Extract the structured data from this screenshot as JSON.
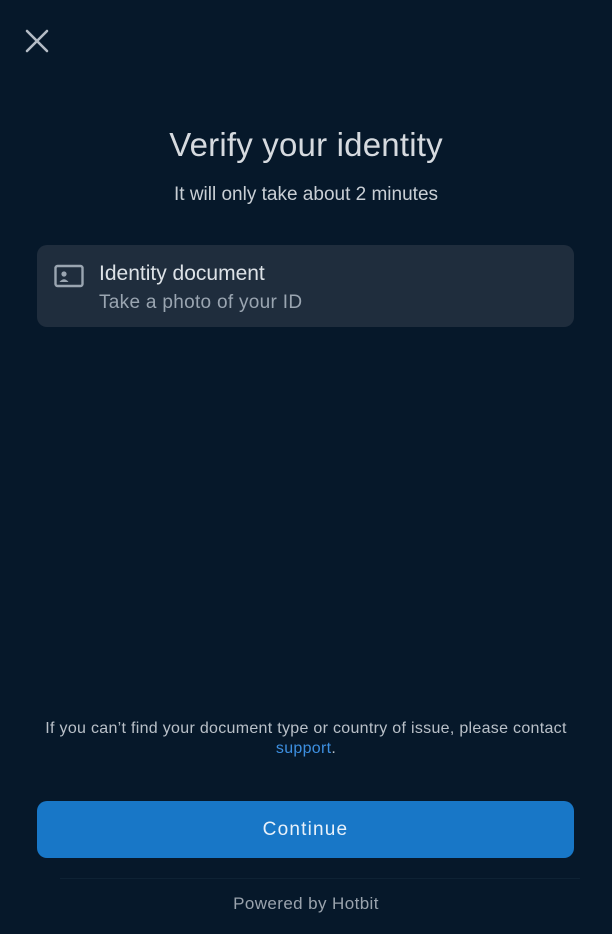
{
  "header": {
    "close_icon": "close-icon"
  },
  "main": {
    "title": "Verify your identity",
    "subtitle": "It will only take about 2 minutes",
    "document_option": {
      "icon": "id-card-icon",
      "title": "Identity document",
      "subtitle": "Take a photo of your ID"
    }
  },
  "footer": {
    "help_text": "If you can’t find your document type or country of issue, please contact ",
    "support_link": "support",
    "help_text_end": ".",
    "continue_label": "Continue",
    "powered_by": "Powered by Hotbit"
  },
  "colors": {
    "background": "#06182a",
    "card": "#1f2d3d",
    "accent": "#1877c7",
    "link": "#3d8fe0"
  }
}
